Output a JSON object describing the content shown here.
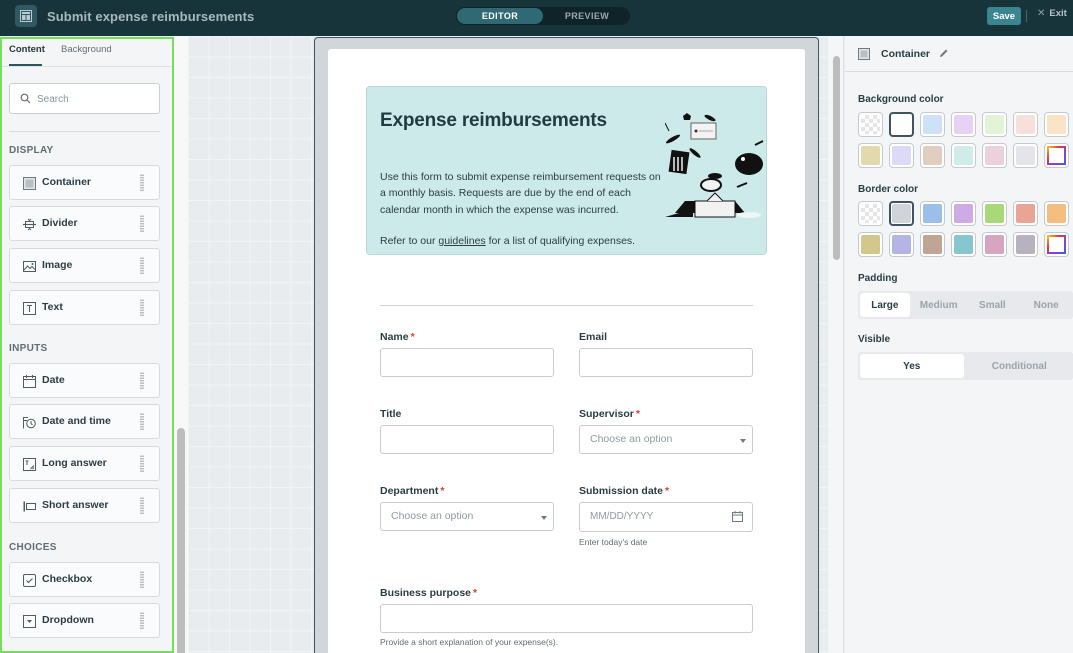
{
  "topbar": {
    "app_title": "Submit expense reimbursements",
    "modes": [
      {
        "label": "EDITOR",
        "active": true
      },
      {
        "label": "PREVIEW",
        "active": false
      }
    ],
    "save_label": "Save",
    "exit_label": "Exit"
  },
  "left_panel": {
    "tabs": [
      {
        "label": "Content",
        "active": true
      },
      {
        "label": "Background",
        "active": false
      }
    ],
    "search_placeholder": "Search",
    "sections": [
      {
        "heading": "DISPLAY",
        "items": [
          {
            "label": "Container",
            "icon": "container-icon"
          },
          {
            "label": "Divider",
            "icon": "divider-icon"
          },
          {
            "label": "Image",
            "icon": "image-icon"
          },
          {
            "label": "Text",
            "icon": "text-icon"
          }
        ]
      },
      {
        "heading": "INPUTS",
        "items": [
          {
            "label": "Date",
            "icon": "calendar-icon"
          },
          {
            "label": "Date and time",
            "icon": "datetime-icon"
          },
          {
            "label": "Long answer",
            "icon": "long-answer-icon"
          },
          {
            "label": "Short answer",
            "icon": "short-answer-icon"
          }
        ]
      },
      {
        "heading": "CHOICES",
        "items": [
          {
            "label": "Checkbox",
            "icon": "checkbox-icon"
          },
          {
            "label": "Dropdown",
            "icon": "dropdown-icon"
          }
        ]
      }
    ]
  },
  "form": {
    "hero": {
      "title": "Expense reimbursements",
      "description": "Use this form to submit expense reimbursement requests on a monthly basis. Requests are due by the end of each calendar month in which the expense was incurred.",
      "refer_prefix": "Refer to our ",
      "refer_link": "guidelines",
      "refer_suffix": " for a list of qualifying expenses.",
      "background_color": "#cdeaea"
    },
    "fields": {
      "name": {
        "label": "Name",
        "required": "*",
        "value": ""
      },
      "email": {
        "label": "Email",
        "value": ""
      },
      "title": {
        "label": "Title",
        "value": ""
      },
      "supervisor": {
        "label": "Supervisor",
        "required": "*",
        "placeholder": "Choose an option"
      },
      "department": {
        "label": "Department",
        "required": "*",
        "placeholder": "Choose an option"
      },
      "submission_date": {
        "label": "Submission date",
        "required": "*",
        "placeholder": "MM/DD/YYYY",
        "help": "Enter today's date"
      },
      "business_purpose": {
        "label": "Business purpose",
        "required": "*",
        "value": "",
        "help": "Provide a short explanation of your expense(s)."
      }
    }
  },
  "right_panel": {
    "title": "Container",
    "background_color": {
      "label": "Background color",
      "selected_index": 1,
      "swatches": [
        "transparent",
        "#ffffff",
        "#cfe1f7",
        "#e6d3f3",
        "#e3f3d5",
        "#f7dfdc",
        "#fbe3c8",
        "#e2d9ac",
        "#dcdaf6",
        "#e0cfc1",
        "#d0ecea",
        "#ecd1dd",
        "#e5e4ea",
        "custom"
      ]
    },
    "border_color": {
      "label": "Border color",
      "selected_index": 1,
      "swatches": [
        "transparent",
        "#d1d5db",
        "#9bbeea",
        "#cfabe3",
        "#a9d878",
        "#e8a595",
        "#f5bd80",
        "#d3c78c",
        "#b5b5e5",
        "#c0a595",
        "#85c7cd",
        "#d7a5bf",
        "#b8b2c0",
        "custom"
      ]
    },
    "padding": {
      "label": "Padding",
      "options": [
        "Large",
        "Medium",
        "Small",
        "None"
      ],
      "selected": "Large"
    },
    "visible": {
      "label": "Visible",
      "options": [
        "Yes",
        "Conditional"
      ],
      "selected": "Yes"
    }
  }
}
